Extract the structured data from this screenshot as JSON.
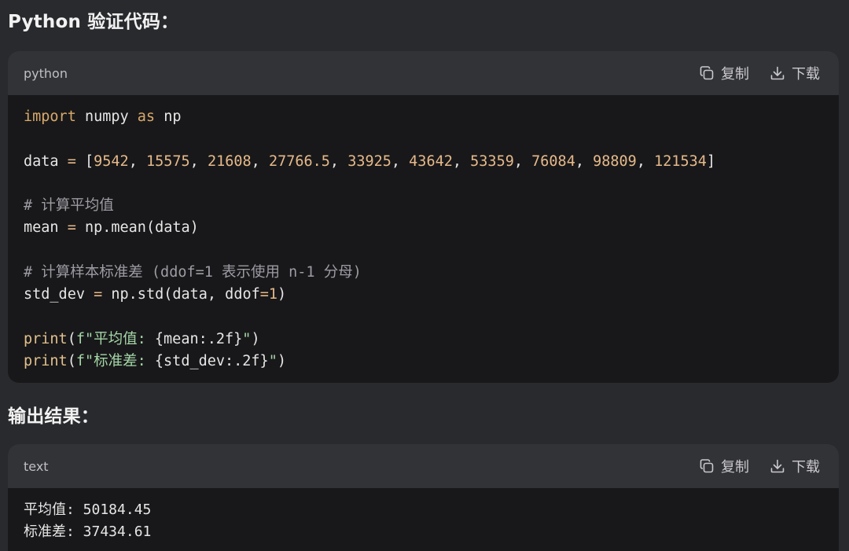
{
  "headings": {
    "verify_code": "Python 验证代码：",
    "output_result": "输出结果："
  },
  "code_block": {
    "language": "python",
    "copy_label": "复制",
    "download_label": "下载",
    "lines": {
      "l1_import": "import",
      "l1_numpy": " numpy ",
      "l1_as": "as",
      "l1_np": " np",
      "l3_data": "data ",
      "l3_eq": "=",
      "l3_open": " [",
      "l3_values": [
        "9542",
        "15575",
        "21608",
        "27766.5",
        "33925",
        "43642",
        "53359",
        "76084",
        "98809",
        "121534"
      ],
      "l3_close": "]",
      "l5_comment": "# 计算平均值",
      "l6_mean": "mean ",
      "l6_eq": "=",
      "l6_rest": " np.mean(data)",
      "l8_comment": "# 计算样本标准差 (ddof=1 表示使用 n-1 分母)",
      "l9_std": "std_dev ",
      "l9_eq": "=",
      "l9_rest": " np.std(data, ddof",
      "l9_eq2": "=",
      "l9_one": "1",
      "l9_close": ")",
      "l11_print": "print",
      "l11_open": "(",
      "l11_fstr": "f\"平均值: ",
      "l11_expr": "{mean:.2f}",
      "l11_end": "\"",
      "l11_close": ")",
      "l12_print": "print",
      "l12_open": "(",
      "l12_fstr": "f\"标准差: ",
      "l12_expr": "{std_dev:.2f}",
      "l12_end": "\"",
      "l12_close": ")"
    }
  },
  "output_block": {
    "language": "text",
    "copy_label": "复制",
    "download_label": "下载",
    "lines": [
      "平均值: 50184.45",
      "标准差: 37434.61"
    ]
  },
  "icons": {
    "copy": "copy-icon",
    "download": "download-icon"
  }
}
